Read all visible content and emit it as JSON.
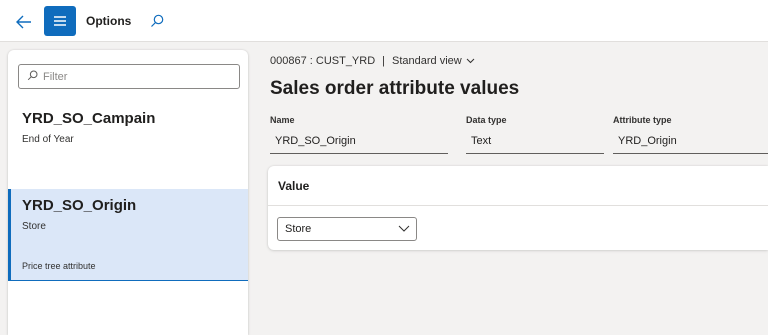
{
  "toolbar": {
    "options_label": "Options",
    "icons": [
      "back-arrow-icon",
      "hamburger-menu-icon",
      "search-icon"
    ]
  },
  "filter": {
    "placeholder": "Filter",
    "value": ""
  },
  "list": {
    "items": [
      {
        "title": "YRD_SO_Campain",
        "subtitle": "End of Year",
        "description": ""
      },
      {
        "title": "YRD_SO_Origin",
        "subtitle": "Store",
        "description": "Price tree attribute",
        "selected": true
      }
    ]
  },
  "header": {
    "record": "000867 : CUST_YRD",
    "separator": "|",
    "view": "Standard view",
    "title": "Sales order attribute values"
  },
  "fields": [
    {
      "label": "Name",
      "value": "YRD_SO_Origin"
    },
    {
      "label": "Data type",
      "value": "Text"
    },
    {
      "label": "Attribute type",
      "value": "YRD_Origin"
    }
  ],
  "value_section": {
    "heading": "Value",
    "selected": "Store"
  },
  "colors": {
    "accent": "#0f6cbd",
    "selected_bg": "#dbe7f8",
    "page_bg": "#f3f2f1"
  }
}
